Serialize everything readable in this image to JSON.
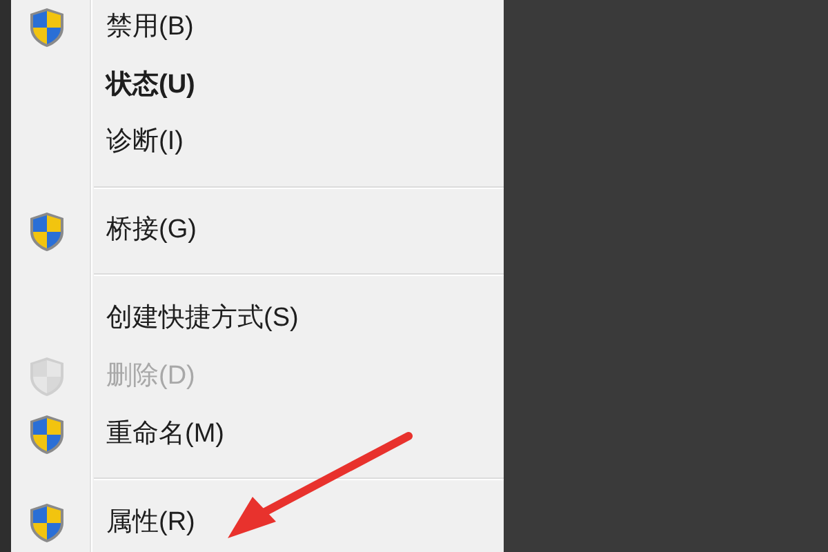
{
  "menu": {
    "items": [
      {
        "kind": "shield_item",
        "label": "禁用(B)",
        "bold": false,
        "disabled": false
      },
      {
        "kind": "item",
        "label": "状态(U)",
        "bold": true,
        "disabled": false
      },
      {
        "kind": "item",
        "label": "诊断(I)",
        "bold": false,
        "disabled": false
      },
      {
        "kind": "separator"
      },
      {
        "kind": "shield_item",
        "label": "桥接(G)",
        "bold": false,
        "disabled": false
      },
      {
        "kind": "separator"
      },
      {
        "kind": "item",
        "label": "创建快捷方式(S)",
        "bold": false,
        "disabled": false
      },
      {
        "kind": "shield_item",
        "label": "删除(D)",
        "bold": false,
        "disabled": true
      },
      {
        "kind": "shield_item",
        "label": "重命名(M)",
        "bold": false,
        "disabled": false
      },
      {
        "kind": "separator"
      },
      {
        "kind": "shield_item",
        "label": "属性(R)",
        "bold": false,
        "disabled": false
      }
    ]
  }
}
